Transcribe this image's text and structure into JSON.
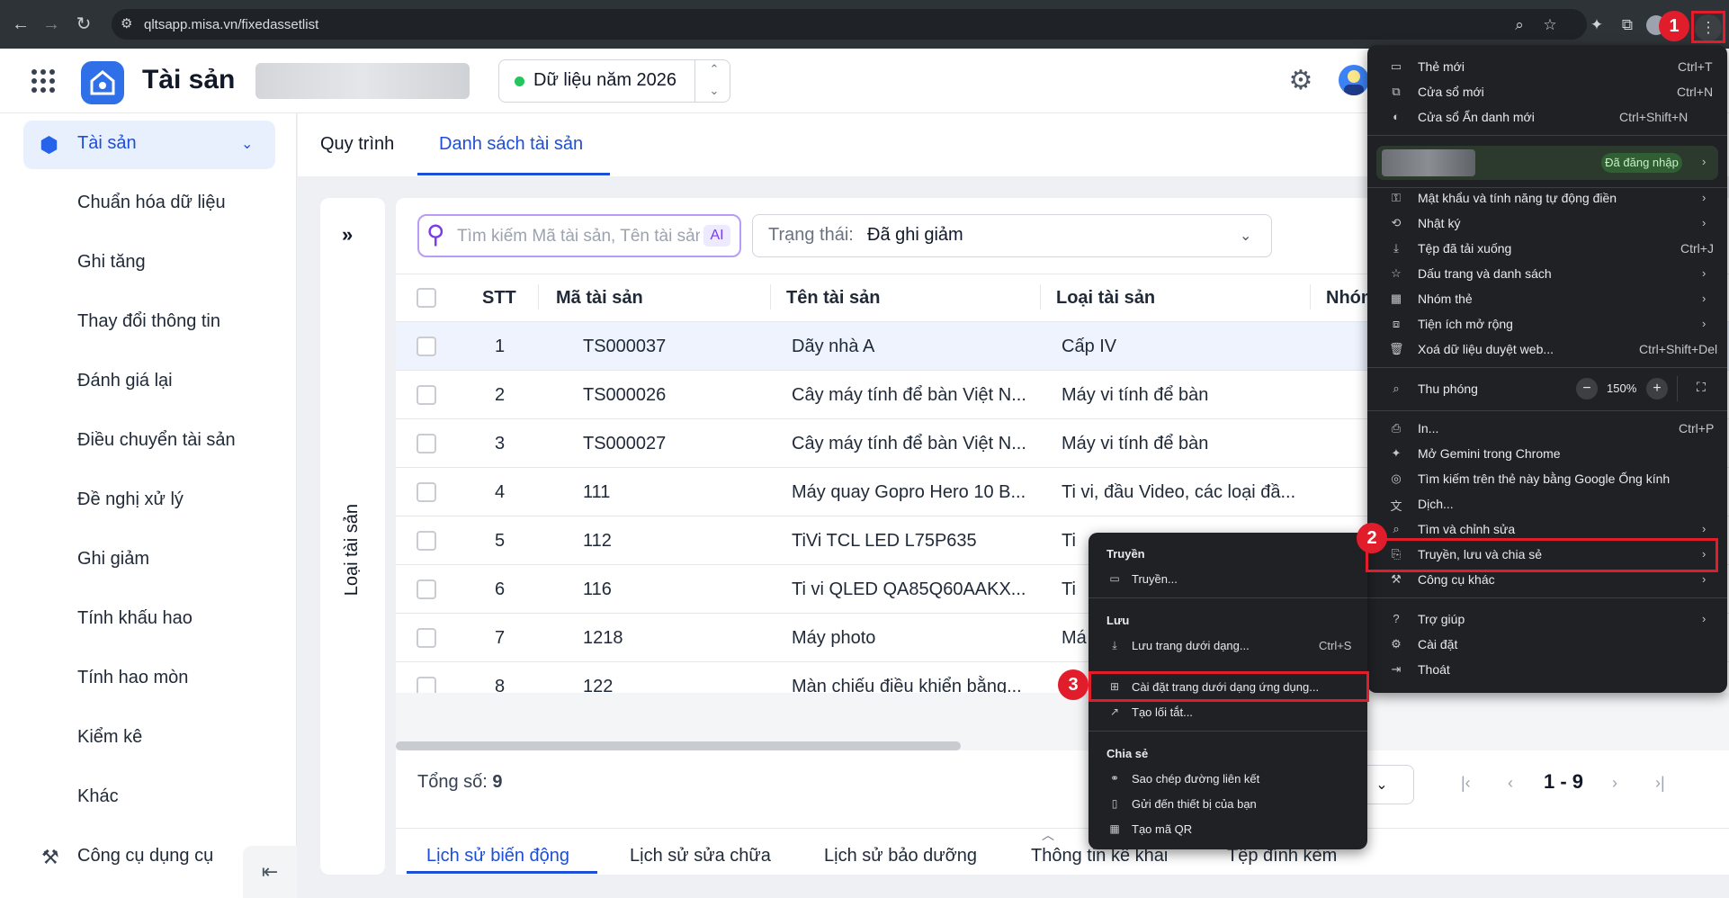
{
  "browser": {
    "url": "qltsapp.misa.vn/fixedassetlist",
    "icons": [
      "back-icon",
      "forward-icon",
      "reload-icon",
      "site-info-icon",
      "zoom-icon",
      "star-icon",
      "extension-icon",
      "puzzle-icon",
      "profile-icon",
      "kebab-menu-icon"
    ]
  },
  "header": {
    "title": "Tài sản",
    "year_label": "Dữ liệu năm 2026",
    "year_up": "⌃",
    "year_down": "⌄"
  },
  "sidebar": {
    "active": "Tài sản",
    "items": [
      "Chuẩn hóa dữ liệu",
      "Ghi tăng",
      "Thay đổi thông tin",
      "Đánh giá lại",
      "Điều chuyển tài sản",
      "Đề nghị xử lý",
      "Ghi giảm",
      "Tính khấu hao",
      "Tính hao mòn",
      "Kiểm kê",
      "Khác",
      "Công cụ dụng cụ"
    ]
  },
  "tabs": [
    "Quy trình",
    "Danh sách tài sản"
  ],
  "panel": {
    "vertical_label": "Loại tài sản",
    "search_placeholder": "Tìm kiếm Mã tài sản, Tên tài sản",
    "ai": "AI",
    "status_label": "Trạng thái:",
    "status_value": "Đã ghi giảm"
  },
  "table": {
    "headers": [
      "STT",
      "Mã tài sản",
      "Tên tài sản",
      "Loại tài sản",
      "Nhóm"
    ],
    "rows": [
      [
        "1",
        "TS000037",
        "Dãy nhà A",
        "Cấp IV"
      ],
      [
        "2",
        "TS000026",
        "Cây máy tính để bàn Việt N...",
        "Máy vi tính để bàn"
      ],
      [
        "3",
        "TS000027",
        "Cây máy tính để bàn Việt N...",
        "Máy vi tính để bàn"
      ],
      [
        "4",
        "111",
        "Máy quay Gopro Hero 10 B...",
        "Ti vi, đầu Video, các loại đầ..."
      ],
      [
        "5",
        "112",
        "TiVi TCL LED L75P635",
        "Ti"
      ],
      [
        "6",
        "116",
        "Ti vi QLED QA85Q60AAKX...",
        "Ti"
      ],
      [
        "7",
        "1218",
        "Máy photo",
        "Má"
      ],
      [
        "8",
        "122",
        "Màn chiếu điều khiển bằng...",
        ""
      ]
    ]
  },
  "footer": {
    "total_label": "Tổng số:",
    "total_value": "9",
    "page_range": "1 - 9"
  },
  "bottom_tabs": [
    "Lịch sử biến động",
    "Lịch sử sửa chữa",
    "Lịch sử bảo dưỡng",
    "Thông tin kê khai",
    "Tệp đính kèm"
  ],
  "chrome_menu": {
    "items": [
      {
        "label": "Thẻ mới",
        "shortcut": "Ctrl+T"
      },
      {
        "label": "Cửa sổ mới",
        "shortcut": "Ctrl+N"
      },
      {
        "label": "Cửa sổ Ẩn danh mới",
        "shortcut": "Ctrl+Shift+N"
      },
      {
        "label": "Mật khẩu và tính năng tự động điền",
        "shortcut": ""
      },
      {
        "label": "Nhật ký",
        "shortcut": ""
      },
      {
        "label": "Tệp đã tải xuống",
        "shortcut": "Ctrl+J"
      },
      {
        "label": "Dấu trang và danh sách",
        "shortcut": ""
      },
      {
        "label": "Nhóm thẻ",
        "shortcut": ""
      },
      {
        "label": "Tiện ích mở rộng",
        "shortcut": ""
      },
      {
        "label": "Xoá dữ liệu duyệt web...",
        "shortcut": "Ctrl+Shift+Del"
      },
      {
        "label": "Thu phóng",
        "shortcut": ""
      },
      {
        "label": "In...",
        "shortcut": "Ctrl+P"
      },
      {
        "label": "Mở Gemini trong Chrome",
        "shortcut": ""
      },
      {
        "label": "Tìm kiếm trên thẻ này bằng Google Ống kính",
        "shortcut": ""
      },
      {
        "label": "Dịch...",
        "shortcut": ""
      },
      {
        "label": "Tìm và chỉnh sửa",
        "shortcut": ""
      },
      {
        "label": "Truyền, lưu và chia sẻ",
        "shortcut": ""
      },
      {
        "label": "Công cụ khác",
        "shortcut": ""
      },
      {
        "label": "Trợ giúp",
        "shortcut": ""
      },
      {
        "label": "Cài đặt",
        "shortcut": ""
      },
      {
        "label": "Thoát",
        "shortcut": ""
      }
    ],
    "signed_in": "Đã đăng nhập",
    "zoom": "150%",
    "zoom_minus": "−",
    "zoom_plus": "+"
  },
  "submenu": {
    "cast_header": "Truyền",
    "cast_item": "Truyền...",
    "save_header": "Lưu",
    "save_as": "Lưu trang dưới dạng...",
    "save_shortcut": "Ctrl+S",
    "install_app": "Cài đặt trang dưới dạng ứng dụng...",
    "shortcut": "Tạo lối tắt...",
    "share_header": "Chia sẻ",
    "copy_link": "Sao chép đường liên kết",
    "send_device": "Gửi đến thiết bị của bạn",
    "qr": "Tạo mã QR"
  },
  "annotations": [
    "1",
    "2",
    "3"
  ],
  "colors": {
    "accent": "#1d4ed8",
    "highlight": "#e11d2c",
    "menu_bg": "#202124"
  }
}
